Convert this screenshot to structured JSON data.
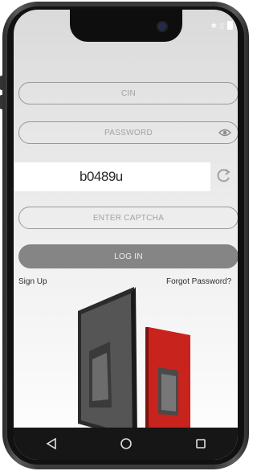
{
  "status": {
    "icons": [
      "notification-icon",
      "sim-icon",
      "battery-icon"
    ]
  },
  "form": {
    "cin_placeholder": "CIN",
    "password_placeholder": "PASSWORD",
    "captcha_code": "b0489u",
    "captcha_placeholder": "ENTER CAPTCHA",
    "login_label": "LOG IN",
    "signup_label": "Sign Up",
    "forgot_label": "Forgot Password?"
  },
  "navbar": {
    "icons": [
      "back-icon",
      "home-icon",
      "recents-icon"
    ]
  },
  "colors": {
    "button": "#858585",
    "field_border": "#999999",
    "navbar": "#161616",
    "promo_red": "#c8231c"
  }
}
